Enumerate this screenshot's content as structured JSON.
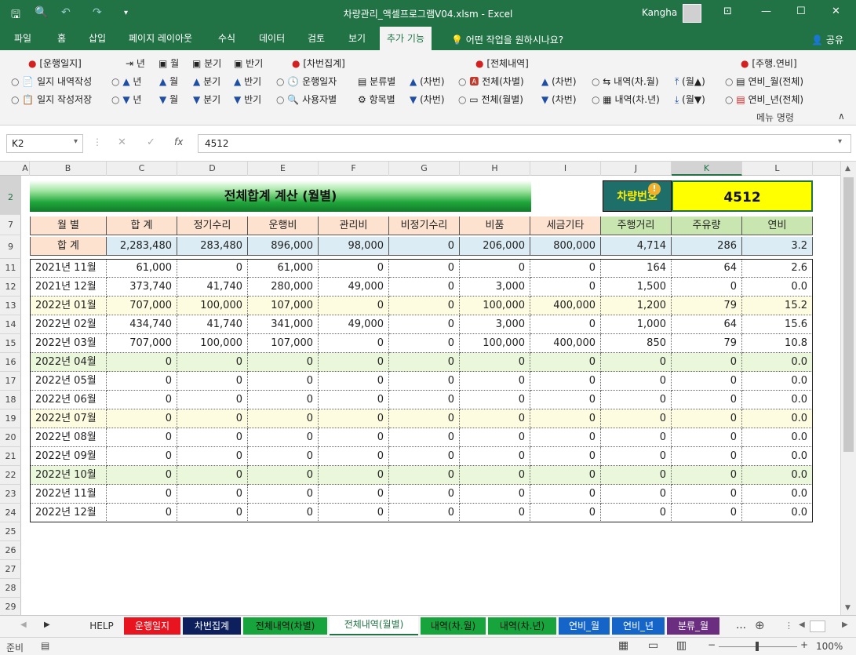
{
  "app": {
    "title": "차량관리_액셀프로그램V04.xlsm  -  Excel",
    "user": "Kangha"
  },
  "menu": {
    "tabs": [
      "파일",
      "홈",
      "삽입",
      "페이지 레이아웃",
      "수식",
      "데이터",
      "검토",
      "보기",
      "추가 기능"
    ],
    "active": "추가 기능",
    "tell_me": "어떤 작업을 원하시나요?",
    "share": "공유"
  },
  "ribbon": {
    "g1": {
      "title": "[운행일지]",
      "r1": "일지 내역작성",
      "r2": "일지 작성저장"
    },
    "g1b": {
      "h1": "년",
      "h2": "월",
      "h3": "분기",
      "h4": "반기",
      "a1": "년",
      "a2": "월",
      "a3": "분기",
      "a4": "반기",
      "b1": "년",
      "b2": "월",
      "b3": "분기",
      "b4": "반기"
    },
    "g2": {
      "title": "[차번집계]",
      "r1": "운행일자",
      "r2": "사용자별",
      "r1b": "분류별",
      "r2b": "항목별",
      "r1c": "(차번)",
      "r2c": "(차번)"
    },
    "g3": {
      "title": "[전체내역]",
      "r1": "전체(차별)",
      "r2": "전체(월별)",
      "r1b": "(차번)",
      "r2b": "(차번)",
      "r1c": "내역(차.월)",
      "r2c": "내역(차.년)",
      "r1d": "(월▲)",
      "r2d": "(월▼)"
    },
    "g4": {
      "title": "[주행.연비]",
      "r1": "연비_월(전체)",
      "r2": "연비_년(전체)"
    },
    "group_label": "메뉴 명령"
  },
  "formula": {
    "namebox": "K2",
    "fx": "fx",
    "value": "4512"
  },
  "columns": [
    "A",
    "B",
    "C",
    "D",
    "E",
    "F",
    "G",
    "H",
    "I",
    "J",
    "K",
    "L"
  ],
  "rows": [
    "2",
    "7",
    "9",
    "11",
    "12",
    "13",
    "14",
    "15",
    "16",
    "17",
    "18",
    "19",
    "20",
    "21",
    "22",
    "23",
    "24",
    "25",
    "26",
    "27",
    "28",
    "29"
  ],
  "sheet": {
    "banner": "전체합계 계산 (월별)",
    "car_label": "차량번호",
    "car_number": "4512",
    "headers": [
      "월  별",
      "합  계",
      "정기수리",
      "운행비",
      "관리비",
      "비정기수리",
      "비품",
      "세금기타",
      "주행거리",
      "주유량",
      "연비"
    ],
    "total": [
      "합  계",
      "2,283,480",
      "283,480",
      "896,000",
      "98,000",
      "0",
      "206,000",
      "800,000",
      "4,714",
      "286",
      "3.2"
    ],
    "data": [
      [
        "2021년 11월",
        "61,000",
        "0",
        "61,000",
        "0",
        "0",
        "0",
        "0",
        "164",
        "64",
        "2.6"
      ],
      [
        "2021년 12월",
        "373,740",
        "41,740",
        "280,000",
        "49,000",
        "0",
        "3,000",
        "0",
        "1,500",
        "0",
        "0.0"
      ],
      [
        "2022년 01월",
        "707,000",
        "100,000",
        "107,000",
        "0",
        "0",
        "100,000",
        "400,000",
        "1,200",
        "79",
        "15.2"
      ],
      [
        "2022년 02월",
        "434,740",
        "41,740",
        "341,000",
        "49,000",
        "0",
        "3,000",
        "0",
        "1,000",
        "64",
        "15.6"
      ],
      [
        "2022년 03월",
        "707,000",
        "100,000",
        "107,000",
        "0",
        "0",
        "100,000",
        "400,000",
        "850",
        "79",
        "10.8"
      ],
      [
        "2022년 04월",
        "0",
        "0",
        "0",
        "0",
        "0",
        "0",
        "0",
        "0",
        "0",
        "0.0"
      ],
      [
        "2022년 05월",
        "0",
        "0",
        "0",
        "0",
        "0",
        "0",
        "0",
        "0",
        "0",
        "0.0"
      ],
      [
        "2022년 06월",
        "0",
        "0",
        "0",
        "0",
        "0",
        "0",
        "0",
        "0",
        "0",
        "0.0"
      ],
      [
        "2022년 07월",
        "0",
        "0",
        "0",
        "0",
        "0",
        "0",
        "0",
        "0",
        "0",
        "0.0"
      ],
      [
        "2022년 08월",
        "0",
        "0",
        "0",
        "0",
        "0",
        "0",
        "0",
        "0",
        "0",
        "0.0"
      ],
      [
        "2022년 09월",
        "0",
        "0",
        "0",
        "0",
        "0",
        "0",
        "0",
        "0",
        "0",
        "0.0"
      ],
      [
        "2022년 10월",
        "0",
        "0",
        "0",
        "0",
        "0",
        "0",
        "0",
        "0",
        "0",
        "0.0"
      ],
      [
        "2022년 11월",
        "0",
        "0",
        "0",
        "0",
        "0",
        "0",
        "0",
        "0",
        "0",
        "0.0"
      ],
      [
        "2022년 12월",
        "0",
        "0",
        "0",
        "0",
        "0",
        "0",
        "0",
        "0",
        "0",
        "0.0"
      ]
    ]
  },
  "sheet_tabs": [
    {
      "label": "HELP",
      "color": "#f3f3f3",
      "text": "#333"
    },
    {
      "label": "운행일지",
      "color": "#e8141f",
      "text": "#fff"
    },
    {
      "label": "차번집계",
      "color": "#0d1f5c",
      "text": "#fff"
    },
    {
      "label": "전체내역(차별)",
      "color": "#17a43c",
      "text": "#111"
    },
    {
      "label": "전체내역(월별)",
      "color": "#ffffff",
      "text": "#217346"
    },
    {
      "label": "내역(차.월)",
      "color": "#17a43c",
      "text": "#111"
    },
    {
      "label": "내역(차.년)",
      "color": "#17a43c",
      "text": "#111"
    },
    {
      "label": "연비_월",
      "color": "#1565c8",
      "text": "#fff"
    },
    {
      "label": "연비_년",
      "color": "#1565c8",
      "text": "#fff"
    },
    {
      "label": "분류_월",
      "color": "#6a2d7f",
      "text": "#fff"
    }
  ],
  "status": {
    "ready": "준비",
    "zoom": "100%"
  },
  "colors": {
    "excel_green": "#217346",
    "header_peach": "#fde2cf",
    "total_blue": "#dbecf5",
    "stripe_yellow": "#fefce0",
    "stripe_green": "#eaf7da",
    "km_green": "#c9e6b0"
  }
}
